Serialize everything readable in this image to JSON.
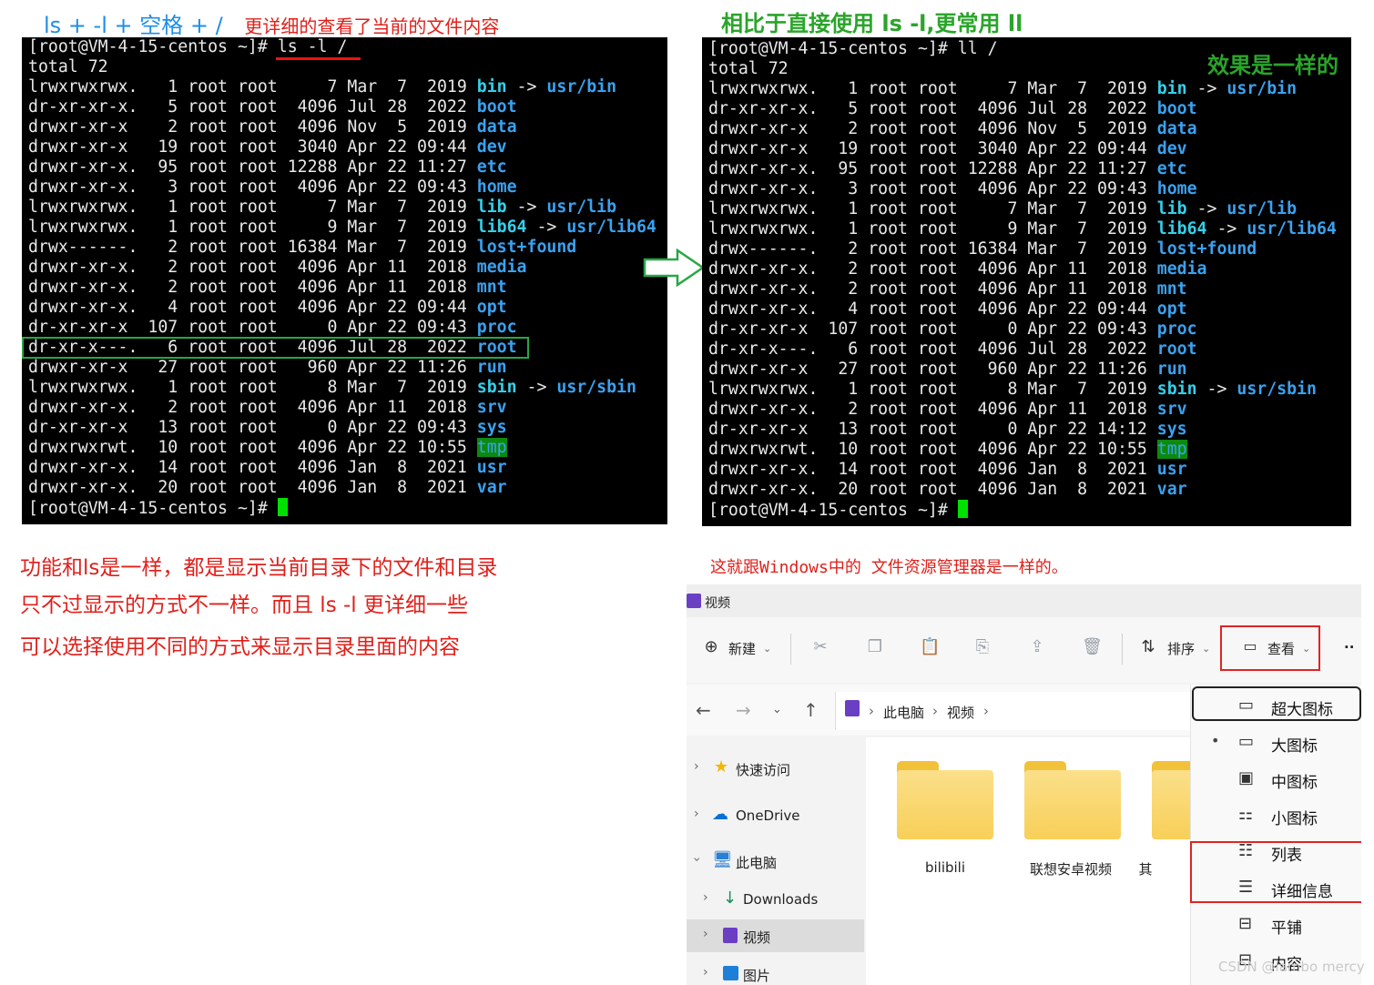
{
  "annotations": {
    "title_left": "ls  + -l + 空格 + /",
    "title_left_sub": "更详细的查看了当前的文件内容",
    "title_right": "相比于直接使用 ls -l,更常用 ll",
    "same_effect": "效果是一样的",
    "note_1": "功能和ls是一样，都是显示当前目录下的文件和目录",
    "note_2": "只不过显示的方式不一样。而且 ls -l 更详细一些",
    "note_3": "可以选择使用不同的方式来显示目录里面的内容",
    "note_explorer": "这就跟Windows中的 文件资源管理器是一样的。"
  },
  "terminal_left": {
    "prompt": "[root@VM-4-15-centos ~]# ",
    "command": "ls -l /",
    "total": "total 72",
    "rows": [
      {
        "meta": "lrwxrwxrwx.   1 root root     7 Mar  7  2019 ",
        "name": "bin",
        "kind": "link",
        "target": "usr/bin"
      },
      {
        "meta": "dr-xr-xr-x.   5 root root  4096 Jul 28  2022 ",
        "name": "boot",
        "kind": "dir"
      },
      {
        "meta": "drwxr-xr-x    2 root root  4096 Nov  5  2019 ",
        "name": "data",
        "kind": "dir"
      },
      {
        "meta": "drwxr-xr-x   19 root root  3040 Apr 22 09:44 ",
        "name": "dev",
        "kind": "dir"
      },
      {
        "meta": "drwxr-xr-x.  95 root root 12288 Apr 22 11:27 ",
        "name": "etc",
        "kind": "dir"
      },
      {
        "meta": "drwxr-xr-x.   3 root root  4096 Apr 22 09:43 ",
        "name": "home",
        "kind": "dir"
      },
      {
        "meta": "lrwxrwxrwx.   1 root root     7 Mar  7  2019 ",
        "name": "lib",
        "kind": "link",
        "target": "usr/lib"
      },
      {
        "meta": "lrwxrwxrwx.   1 root root     9 Mar  7  2019 ",
        "name": "lib64",
        "kind": "link",
        "target": "usr/lib64"
      },
      {
        "meta": "drwx------.   2 root root 16384 Mar  7  2019 ",
        "name": "lost+found",
        "kind": "dir"
      },
      {
        "meta": "drwxr-xr-x.   2 root root  4096 Apr 11  2018 ",
        "name": "media",
        "kind": "dir"
      },
      {
        "meta": "drwxr-xr-x.   2 root root  4096 Apr 11  2018 ",
        "name": "mnt",
        "kind": "dir"
      },
      {
        "meta": "drwxr-xr-x.   4 root root  4096 Apr 22 09:44 ",
        "name": "opt",
        "kind": "dir"
      },
      {
        "meta": "dr-xr-xr-x  107 root root     0 Apr 22 09:43 ",
        "name": "proc",
        "kind": "dir"
      },
      {
        "meta": "dr-xr-x---.   6 root root  4096 Jul 28  2022 ",
        "name": "root",
        "kind": "dir"
      },
      {
        "meta": "drwxr-xr-x   27 root root   960 Apr 22 11:26 ",
        "name": "run",
        "kind": "dir"
      },
      {
        "meta": "lrwxrwxrwx.   1 root root     8 Mar  7  2019 ",
        "name": "sbin",
        "kind": "link",
        "target": "usr/sbin"
      },
      {
        "meta": "drwxr-xr-x.   2 root root  4096 Apr 11  2018 ",
        "name": "srv",
        "kind": "dir"
      },
      {
        "meta": "dr-xr-xr-x   13 root root     0 Apr 22 09:43 ",
        "name": "sys",
        "kind": "dir"
      },
      {
        "meta": "drwxrwxrwt.  10 root root  4096 Apr 22 10:55 ",
        "name": "tmp",
        "kind": "tmp"
      },
      {
        "meta": "drwxr-xr-x.  14 root root  4096 Jan  8  2021 ",
        "name": "usr",
        "kind": "dir"
      },
      {
        "meta": "drwxr-xr-x.  20 root root  4096 Jan  8  2021 ",
        "name": "var",
        "kind": "dir"
      }
    ],
    "end_prompt": "[root@VM-4-15-centos ~]# "
  },
  "terminal_right": {
    "prompt": "[root@VM-4-15-centos ~]# ",
    "command": "ll /",
    "total": "total 72",
    "rows": [
      {
        "meta": "lrwxrwxrwx.   1 root root     7 Mar  7  2019 ",
        "name": "bin",
        "kind": "link",
        "target": "usr/bin"
      },
      {
        "meta": "dr-xr-xr-x.   5 root root  4096 Jul 28  2022 ",
        "name": "boot",
        "kind": "dir"
      },
      {
        "meta": "drwxr-xr-x    2 root root  4096 Nov  5  2019 ",
        "name": "data",
        "kind": "dir"
      },
      {
        "meta": "drwxr-xr-x   19 root root  3040 Apr 22 09:44 ",
        "name": "dev",
        "kind": "dir"
      },
      {
        "meta": "drwxr-xr-x.  95 root root 12288 Apr 22 11:27 ",
        "name": "etc",
        "kind": "dir"
      },
      {
        "meta": "drwxr-xr-x.   3 root root  4096 Apr 22 09:43 ",
        "name": "home",
        "kind": "dir"
      },
      {
        "meta": "lrwxrwxrwx.   1 root root     7 Mar  7  2019 ",
        "name": "lib",
        "kind": "link",
        "target": "usr/lib"
      },
      {
        "meta": "lrwxrwxrwx.   1 root root     9 Mar  7  2019 ",
        "name": "lib64",
        "kind": "link",
        "target": "usr/lib64"
      },
      {
        "meta": "drwx------.   2 root root 16384 Mar  7  2019 ",
        "name": "lost+found",
        "kind": "dir"
      },
      {
        "meta": "drwxr-xr-x.   2 root root  4096 Apr 11  2018 ",
        "name": "media",
        "kind": "dir"
      },
      {
        "meta": "drwxr-xr-x.   2 root root  4096 Apr 11  2018 ",
        "name": "mnt",
        "kind": "dir"
      },
      {
        "meta": "drwxr-xr-x.   4 root root  4096 Apr 22 09:44 ",
        "name": "opt",
        "kind": "dir"
      },
      {
        "meta": "dr-xr-xr-x  107 root root     0 Apr 22 09:43 ",
        "name": "proc",
        "kind": "dir"
      },
      {
        "meta": "dr-xr-x---.   6 root root  4096 Jul 28  2022 ",
        "name": "root",
        "kind": "dir"
      },
      {
        "meta": "drwxr-xr-x   27 root root   960 Apr 22 11:26 ",
        "name": "run",
        "kind": "dir"
      },
      {
        "meta": "lrwxrwxrwx.   1 root root     8 Mar  7  2019 ",
        "name": "sbin",
        "kind": "link",
        "target": "usr/sbin"
      },
      {
        "meta": "drwxr-xr-x.   2 root root  4096 Apr 11  2018 ",
        "name": "srv",
        "kind": "dir"
      },
      {
        "meta": "dr-xr-xr-x   13 root root     0 Apr 22 14:12 ",
        "name": "sys",
        "kind": "dir"
      },
      {
        "meta": "drwxrwxrwt.  10 root root  4096 Apr 22 10:55 ",
        "name": "tmp",
        "kind": "tmp"
      },
      {
        "meta": "drwxr-xr-x.  14 root root  4096 Jan  8  2021 ",
        "name": "usr",
        "kind": "dir"
      },
      {
        "meta": "drwxr-xr-x.  20 root root  4096 Jan  8  2021 ",
        "name": "var",
        "kind": "dir"
      }
    ],
    "end_prompt": "[root@VM-4-15-centos ~]# "
  },
  "explorer": {
    "title": "视频",
    "toolbar": {
      "new_label": "新建",
      "sort_label": "排序",
      "view_label": "查看",
      "more_label": "··"
    },
    "breadcrumb": [
      "此电脑",
      "视频"
    ],
    "sidebar": [
      {
        "label": "快速访问",
        "icon": "star-icon"
      },
      {
        "label": "OneDrive",
        "icon": "cloud-icon"
      },
      {
        "label": "此电脑",
        "icon": "monitor-icon"
      },
      {
        "label": "Downloads",
        "icon": "download-icon"
      },
      {
        "label": "视频",
        "icon": "video-icon"
      },
      {
        "label": "图片",
        "icon": "picture-icon"
      }
    ],
    "folders": [
      "bilibili",
      "联想安卓视频",
      "其"
    ],
    "view_menu": [
      {
        "label": "超大图标",
        "icon": "extra-large-icons-icon"
      },
      {
        "label": "大图标",
        "icon": "large-icons-icon",
        "selected": true
      },
      {
        "label": "中图标",
        "icon": "medium-icons-icon"
      },
      {
        "label": "小图标",
        "icon": "small-icons-icon"
      },
      {
        "label": "列表",
        "icon": "list-icon"
      },
      {
        "label": "详细信息",
        "icon": "details-icon"
      },
      {
        "label": "平铺",
        "icon": "tiles-icon"
      },
      {
        "label": "内容",
        "icon": "content-icon"
      }
    ]
  },
  "watermark": "CSDN @lambo mercy",
  "colors": {
    "annotation_red": "#e0201a",
    "annotation_green": "#2aa52a",
    "annotation_blue": "#1e8ee8",
    "terminal_dir": "#3aa2f0",
    "terminal_link": "#35d0ea",
    "terminal_tmp_bg": "#0c8a0c",
    "cursor": "#00e000"
  }
}
